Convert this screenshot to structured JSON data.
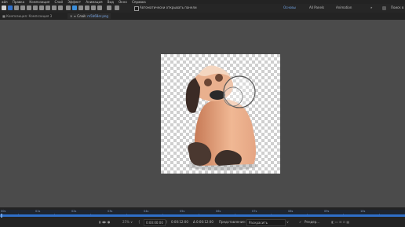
{
  "menubar": {
    "items": [
      "айл",
      "Правка",
      "Композиция",
      "Слой",
      "Эффект",
      "Анимация",
      "Вид",
      "Окно",
      "Справка"
    ]
  },
  "toolbar": {
    "auto_open_panels_label": "Автоматически открывать панели",
    "workspaces": [
      "Основы",
      "All Panels",
      "Animation"
    ],
    "active_workspace_index": 0,
    "search_label": "Поиск в"
  },
  "tabs": {
    "left": "Композиция: Композиция 3",
    "right_prefix": "Слой: ",
    "right_file": "m5b68er.png"
  },
  "timeline": {
    "ruler_labels": [
      "00s",
      "01s",
      "02s",
      "03s",
      "04s",
      "05s",
      "06s",
      "07s",
      "08s",
      "09s",
      "10s"
    ],
    "zoom": "25% ∨",
    "time_current": "0:00:00:00",
    "time_out": "0:00:12:00",
    "time_duration": "Δ 0:00:12:00",
    "view_label": "Представление:",
    "view_value": "Раскрасить",
    "render_label": "Рендер..."
  },
  "colors": {
    "accent_blue": "#2f6fc9",
    "workspace_active": "#6fa0e0"
  }
}
